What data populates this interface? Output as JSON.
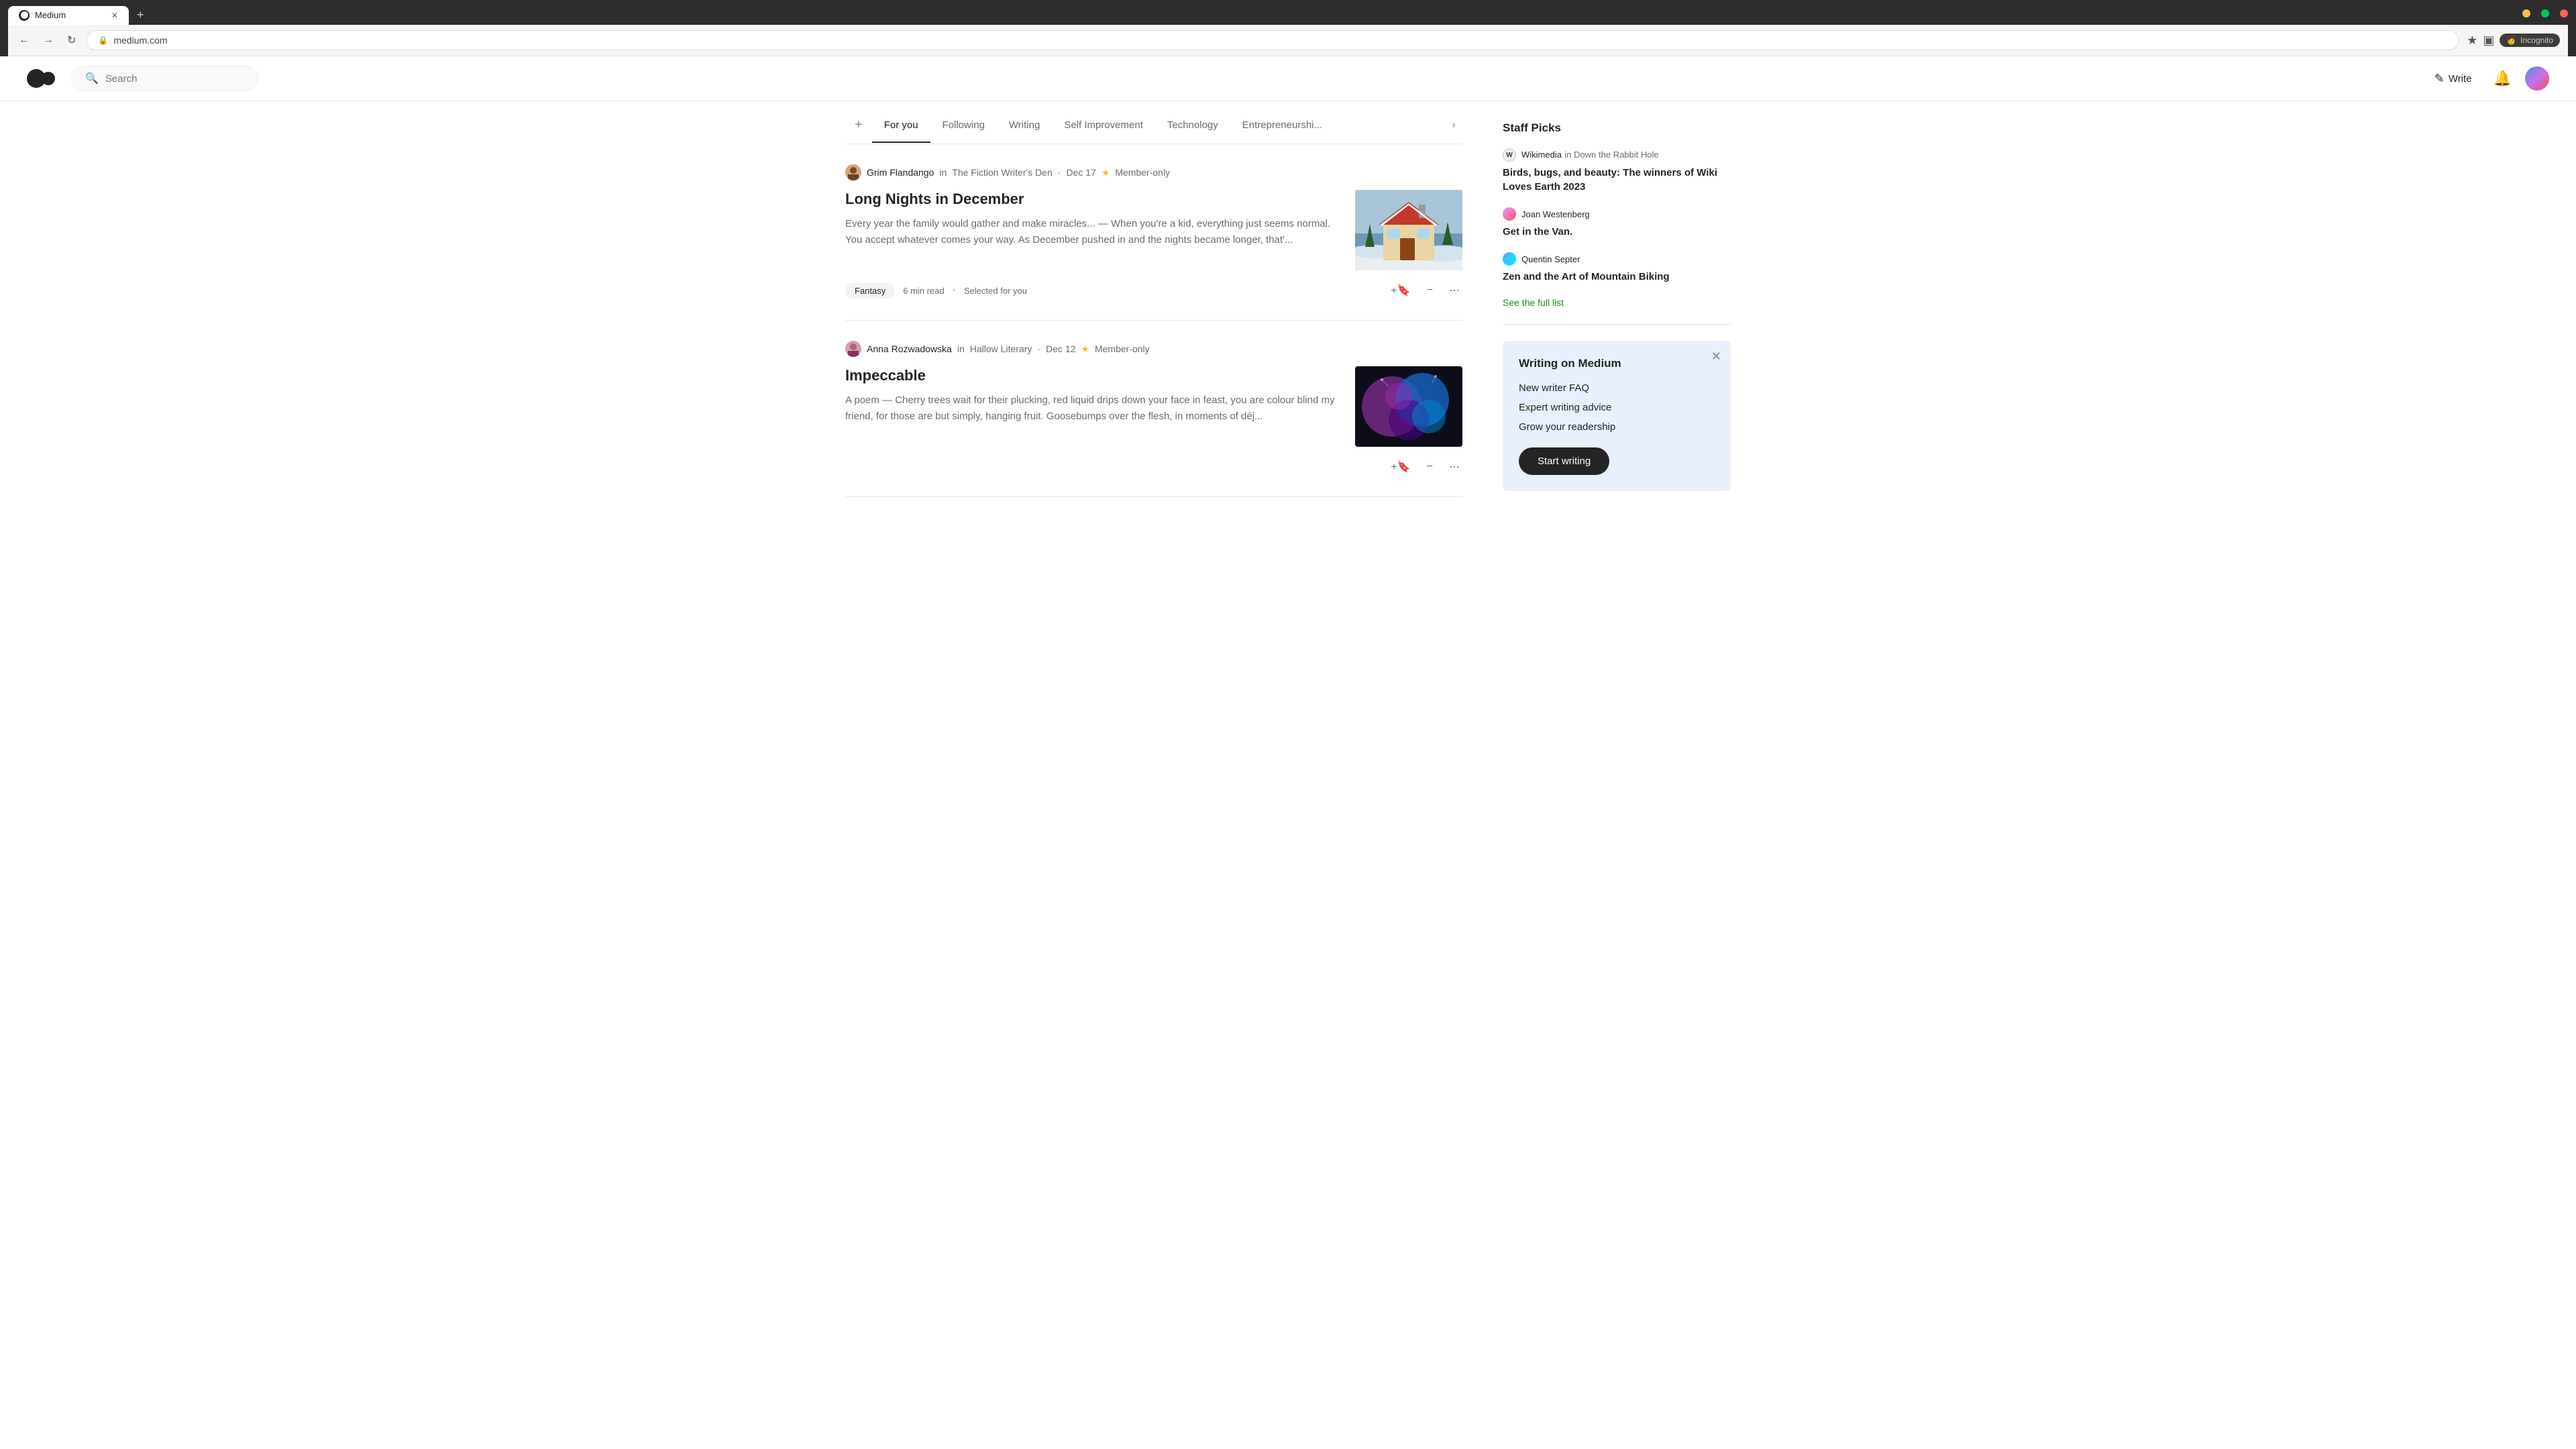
{
  "browser": {
    "tab_label": "Medium",
    "url": "medium.com",
    "incognito_label": "Incognito"
  },
  "header": {
    "search_placeholder": "Search",
    "write_label": "Write",
    "logo_alt": "Medium logo"
  },
  "nav": {
    "add_label": "+",
    "tabs": [
      {
        "id": "for-you",
        "label": "For you",
        "active": true
      },
      {
        "id": "following",
        "label": "Following",
        "active": false
      },
      {
        "id": "writing",
        "label": "Writing",
        "active": false
      },
      {
        "id": "self-improvement",
        "label": "Self Improvement",
        "active": false
      },
      {
        "id": "technology",
        "label": "Technology",
        "active": false
      },
      {
        "id": "entrepreneurship",
        "label": "Entrepreneurshi...",
        "active": false
      }
    ],
    "more_label": "›"
  },
  "articles": [
    {
      "id": "article-1",
      "author": "Grim Flandango",
      "in_label": "in",
      "publication": "The Fiction Writer's Den",
      "date": "Dec 17",
      "member_only": true,
      "member_label": "Member-only",
      "title": "Long Nights in December",
      "excerpt": "Every year the family would gather and make miracles... — When you're a kid, everything just seems normal. You accept whatever comes your way. As December pushed in and the nights became longer, that'...",
      "tag": "Fantasy",
      "read_time": "6 min read",
      "selected_for_you": "Selected for you",
      "dot": "·"
    },
    {
      "id": "article-2",
      "author": "Anna Rozwadowska",
      "in_label": "in",
      "publication": "Hallow Literary",
      "date": "Dec 12",
      "member_only": true,
      "member_label": "Member-only",
      "title": "Impeccable",
      "excerpt": "A poem — Cherry trees wait for their plucking, red liquid drips down your face in feast, you are colour blind my friend, for those are but simply, hanging fruit. Goosebumps over the flesh, in moments of déj...",
      "tag": null,
      "read_time": null,
      "selected_for_you": null,
      "dot": "·"
    }
  ],
  "sidebar": {
    "staff_picks_title": "Staff Picks",
    "picks": [
      {
        "id": "pick-1",
        "author": "Wikimedia",
        "in_label": "in",
        "publication": "Down the Rabbit Hole",
        "article_title": "Birds, bugs, and beauty: The winners of Wiki Loves Earth 2023",
        "avatar_type": "wikimedia"
      },
      {
        "id": "pick-2",
        "author": "Joan Westenberg",
        "article_title": "Get in the Van.",
        "avatar_type": "pink"
      },
      {
        "id": "pick-3",
        "author": "Quentin Septer",
        "article_title": "Zen and the Art of Mountain Biking",
        "avatar_type": "blue"
      }
    ],
    "see_full_list": "See the full list",
    "writing_card": {
      "title": "Writing on Medium",
      "links": [
        "New writer FAQ",
        "Expert writing advice",
        "Grow your readership"
      ],
      "start_button": "Start writing"
    }
  }
}
